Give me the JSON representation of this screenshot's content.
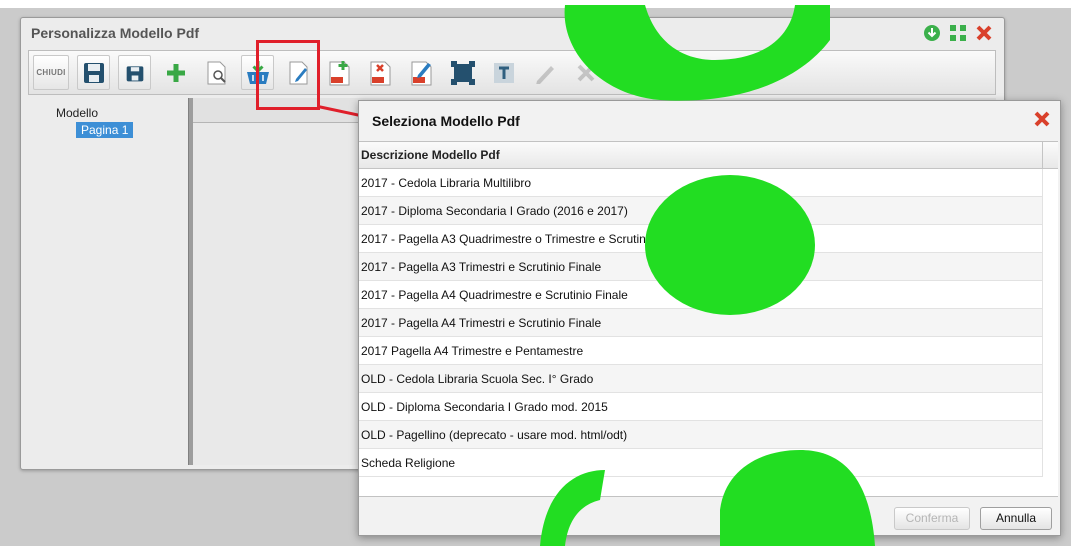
{
  "window": {
    "title": "Personalizza Modello Pdf"
  },
  "toolbar": {
    "close_label": "CHIUDI",
    "buttons": [
      "save-icon",
      "save-small-icon",
      "add-icon",
      "search-document-icon",
      "download-basket-icon",
      "pencil-icon",
      "add-pdf-icon",
      "delete-pdf-icon",
      "edit-pdf-icon",
      "select-area-icon",
      "text-icon",
      "pencil-disabled-icon",
      "delete-disabled-icon",
      "sort-numeric-icon",
      "pdf-document-icon",
      "document-down-icon",
      "document-up-icon"
    ]
  },
  "tree": {
    "root": "Modello",
    "selected_item": "Pagina 1"
  },
  "dialog": {
    "title": "Seleziona Modello Pdf",
    "column_header": "Descrizione Modello Pdf",
    "rows": [
      "2017 - Cedola Libraria Multilibro",
      "2017 - Diploma Secondaria I Grado (2016 e 2017)",
      "2017 - Pagella A3 Quadrimestre o Trimestre e Scrutinio Finale",
      "2017 - Pagella A3 Trimestri e Scrutinio Finale",
      "2017 - Pagella A4 Quadrimestre e Scrutinio Finale",
      "2017 - Pagella A4 Trimestri e Scrutinio Finale",
      "2017 Pagella A4 Trimestre e Pentamestre",
      "OLD - Cedola Libraria Scuola Sec. I° Grado",
      "OLD - Diploma Secondaria I Grado mod. 2015",
      "OLD - Pagellino (deprecato - usare mod. html/odt)",
      "Scheda Religione"
    ],
    "confirm_label": "Conferma",
    "cancel_label": "Annulla"
  },
  "colors": {
    "highlight": "#e01f2a",
    "selection": "#3d8fd6",
    "overlay_green": "#22dd22",
    "close_red": "#d9402b",
    "window_green": "#3bb04b"
  }
}
